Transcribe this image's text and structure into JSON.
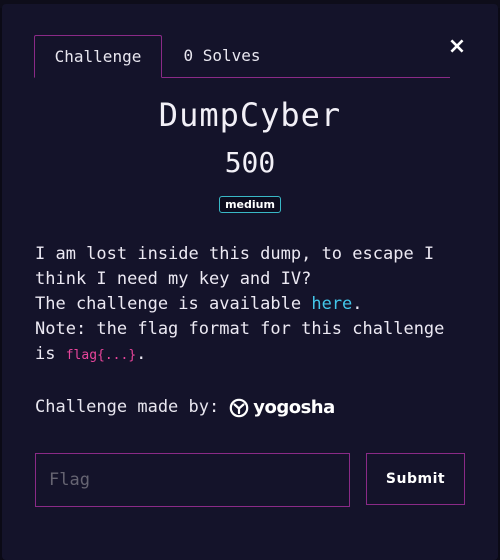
{
  "modal": {
    "close_glyph": "×",
    "tabs": [
      {
        "label": "Challenge",
        "active": true
      },
      {
        "label": "0 Solves",
        "active": false
      }
    ],
    "challenge": {
      "name": "DumpCyber",
      "points": "500",
      "difficulty": "medium",
      "description": {
        "line1": "I am lost inside this dump, to escape I think I need my key and IV?",
        "line2_prefix": "The challenge is available ",
        "line2_link": "here",
        "line2_suffix": ".",
        "line3_prefix": "Note: the flag format for this challenge is ",
        "line3_code": "flag{...}",
        "line3_suffix": "."
      },
      "made_by_label": "Challenge made by:",
      "author_logo_text": "yogosha"
    },
    "form": {
      "flag_placeholder": "Flag",
      "flag_value": "",
      "submit_label": "Submit"
    }
  },
  "colors": {
    "background": "#0b0a16",
    "modal": "#14132a",
    "accent_border": "#8a2a87",
    "link": "#43c6e9",
    "code": "#e8459b",
    "badge_border": "#39b8c6"
  },
  "icons": {
    "close": "close-icon",
    "logo": "yogosha-logo-icon"
  }
}
